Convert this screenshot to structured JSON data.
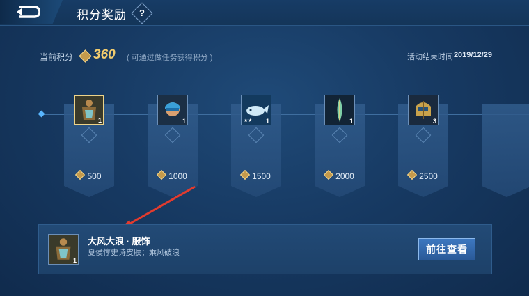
{
  "header": {
    "title": "积分奖励",
    "help_label": "?"
  },
  "points": {
    "label": "当前积分",
    "value": "360",
    "hint": "( 可通过做任务获得积分 )",
    "end_label": "活动结束时间",
    "end_date": "2019/12/29"
  },
  "rewards": [
    {
      "cost": "500",
      "qty": "1",
      "icon": "costume-icon",
      "selected": true
    },
    {
      "cost": "1000",
      "qty": "1",
      "icon": "avatar-icon"
    },
    {
      "cost": "1500",
      "qty": "1",
      "icon": "whale-icon"
    },
    {
      "cost": "2000",
      "qty": "1",
      "icon": "feather-icon"
    },
    {
      "cost": "2500",
      "qty": "3",
      "icon": "helmet-icon"
    }
  ],
  "detail": {
    "name": "大风大浪 · 服饰",
    "description": "夏侯惇史诗皮肤；乘风破浪",
    "qty": "1",
    "button_label": "前往查看"
  },
  "colors": {
    "accent_gold": "#f2cc6e",
    "selected_border": "#ecd38a",
    "button": "#3d78c0"
  }
}
